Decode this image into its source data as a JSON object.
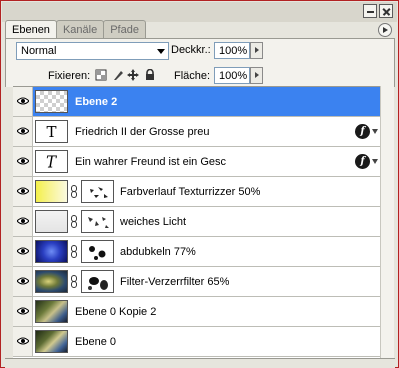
{
  "tabs": [
    {
      "label": "Ebenen",
      "active": true
    },
    {
      "label": "Kanäle",
      "active": false
    },
    {
      "label": "Pfade",
      "active": false
    }
  ],
  "controls": {
    "blend_mode": "Normal",
    "opacity_label": "Deckkr.:",
    "opacity_value": "100%",
    "lock_label": "Fixieren:",
    "fill_label": "Fläche:",
    "fill_value": "100%"
  },
  "layers": [
    {
      "name": "Ebene 2",
      "thumb": "transparent",
      "selected": true
    },
    {
      "name": "Friedrich II  der Grosse  preu",
      "thumb": "type",
      "glyph": "T",
      "fx": true
    },
    {
      "name": "Ein wahrer Freund ist ein Gesc",
      "thumb": "type-warp",
      "glyph": "T",
      "fx": true
    },
    {
      "name": "Farbverlauf Texturrizzer 50%",
      "thumb": "gradient",
      "mask": true
    },
    {
      "name": "weiches Licht",
      "thumb": "light",
      "mask": true
    },
    {
      "name": "abdubkeln 77%",
      "thumb": "blue-radial",
      "mask": true
    },
    {
      "name": "Filter-Verzerrfilter 65%",
      "thumb": "photo-swirl",
      "mask": true
    },
    {
      "name": "Ebene 0 Kopie 2",
      "thumb": "photo"
    },
    {
      "name": "Ebene 0",
      "thumb": "photo"
    }
  ],
  "icons": {
    "visibility": "eye-icon",
    "link": "chain-icon",
    "effects": "fx-icon",
    "panel_menu": "panel-menu-icon"
  },
  "colors": {
    "selection": "#3b82f0",
    "panel_bg": "#e6e5dd"
  }
}
